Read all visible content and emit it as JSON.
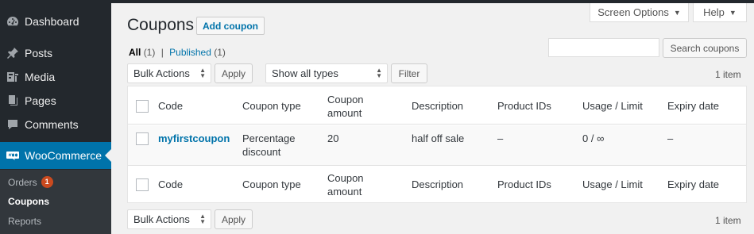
{
  "sidebar": {
    "items": [
      {
        "label": "Dashboard",
        "icon": "dashboard-icon"
      },
      {
        "label": "Posts",
        "icon": "pin-icon"
      },
      {
        "label": "Media",
        "icon": "media-icon"
      },
      {
        "label": "Pages",
        "icon": "pages-icon"
      },
      {
        "label": "Comments",
        "icon": "comment-icon"
      },
      {
        "label": "WooCommerce",
        "icon": "woocommerce-icon"
      }
    ],
    "submenu": [
      {
        "label": "Orders",
        "badge": "1"
      },
      {
        "label": "Coupons"
      },
      {
        "label": "Reports"
      }
    ]
  },
  "header": {
    "screen_options": "Screen Options",
    "help": "Help",
    "title": "Coupons",
    "add_button": "Add coupon"
  },
  "filters": {
    "all_label": "All",
    "all_count": "(1)",
    "separator": "|",
    "published_label": "Published",
    "published_count": "(1)"
  },
  "search": {
    "button": "Search coupons"
  },
  "toolbar": {
    "bulk_actions": "Bulk Actions",
    "apply": "Apply",
    "type_filter": "Show all types",
    "filter": "Filter",
    "count": "1 item"
  },
  "table": {
    "columns": [
      "Code",
      "Coupon type",
      "Coupon amount",
      "Description",
      "Product IDs",
      "Usage / Limit",
      "Expiry date"
    ],
    "columns_wrapped": {
      "amount_line1": "Coupon",
      "amount_line2": "amount"
    },
    "rows": [
      {
        "code": "myfirstcoupon",
        "type_line1": "Percentage",
        "type_line2": "discount",
        "amount": "20",
        "description": "half off sale",
        "product_ids": "–",
        "usage": "0 / ∞",
        "expiry": "–"
      }
    ]
  },
  "colors": {
    "sidebar_bg": "#23282d",
    "accent": "#0073aa",
    "badge": "#ca4a1f"
  }
}
